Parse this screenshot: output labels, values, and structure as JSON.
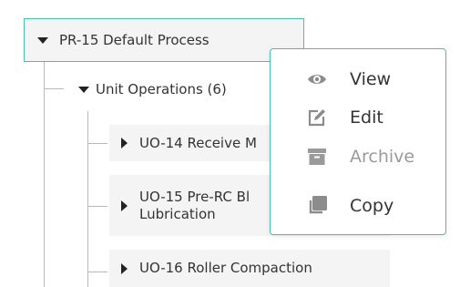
{
  "tree": {
    "root_label": "PR-15 Default Process",
    "group_label": "Unit Operations (6)",
    "items": [
      {
        "label": "UO-14 Receive M"
      },
      {
        "label": "UO-15 Pre-RC Bl\nLubrication"
      },
      {
        "label": "UO-16 Roller Compaction"
      }
    ]
  },
  "context_menu": {
    "items": [
      {
        "label": "View",
        "icon": "eye-icon",
        "enabled": true
      },
      {
        "label": "Edit",
        "icon": "edit-icon",
        "enabled": true
      },
      {
        "label": "Archive",
        "icon": "archive-icon",
        "enabled": false
      },
      {
        "label": "Copy",
        "icon": "copy-icon",
        "enabled": true
      }
    ]
  },
  "colors": {
    "accent_border": "#4bbfaf",
    "node_background": "#f4f4f4",
    "icon_gray": "#8c8c8c",
    "disabled_text": "#9a9a9a"
  }
}
